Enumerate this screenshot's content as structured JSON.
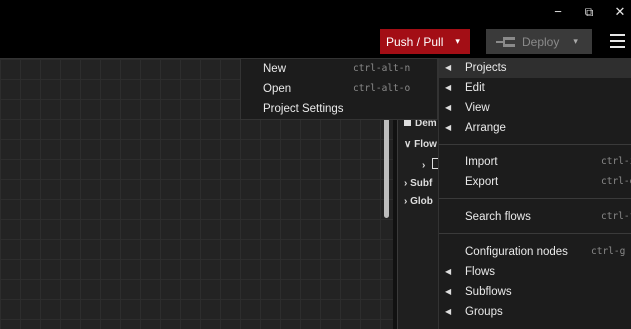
{
  "window": {
    "minimize_glyph": "−",
    "restore_glyph": "⧉",
    "close_glyph": "✕"
  },
  "header": {
    "push_pull_label": "Push / Pull",
    "deploy_label": "Deploy",
    "caret_glyph": "▾"
  },
  "sidebar": {
    "items": [
      {
        "label": "Dem"
      },
      {
        "label": "Flow",
        "prefix": "∨"
      },
      {
        "label": "›",
        "prefix": ""
      },
      {
        "label": "Subf",
        "prefix": "›"
      },
      {
        "label": "Glob",
        "prefix": "›"
      }
    ]
  },
  "submenu": {
    "items": [
      {
        "label": "New",
        "shortcut": "ctrl-alt-n"
      },
      {
        "label": "Open",
        "shortcut": "ctrl-alt-o"
      },
      {
        "label": "Project Settings",
        "shortcut": ""
      }
    ]
  },
  "main_menu": {
    "items": [
      {
        "label": "Projects",
        "shortcut": "",
        "has_submenu": true
      },
      {
        "label": "Edit",
        "shortcut": "",
        "has_submenu": true
      },
      {
        "label": "View",
        "shortcut": "",
        "has_submenu": true
      },
      {
        "label": "Arrange",
        "shortcut": "",
        "has_submenu": true
      },
      {
        "label": "Import",
        "shortcut": "ctrl-i",
        "has_submenu": false
      },
      {
        "label": "Export",
        "shortcut": "ctrl-e",
        "has_submenu": false
      },
      {
        "label": "Search flows",
        "shortcut": "ctrl-f",
        "has_submenu": false
      },
      {
        "label": "Configuration nodes",
        "shortcut": "ctrl-g c",
        "has_submenu": false
      },
      {
        "label": "Flows",
        "shortcut": "",
        "has_submenu": true
      },
      {
        "label": "Subflows",
        "shortcut": "",
        "has_submenu": true
      },
      {
        "label": "Groups",
        "shortcut": "",
        "has_submenu": true
      }
    ],
    "submenu_arrow_glyph": "◀"
  },
  "colors": {
    "push_pull_bg": "#a30e15",
    "menu_bg": "#1c1c1c",
    "workspace_bg": "#232323"
  }
}
